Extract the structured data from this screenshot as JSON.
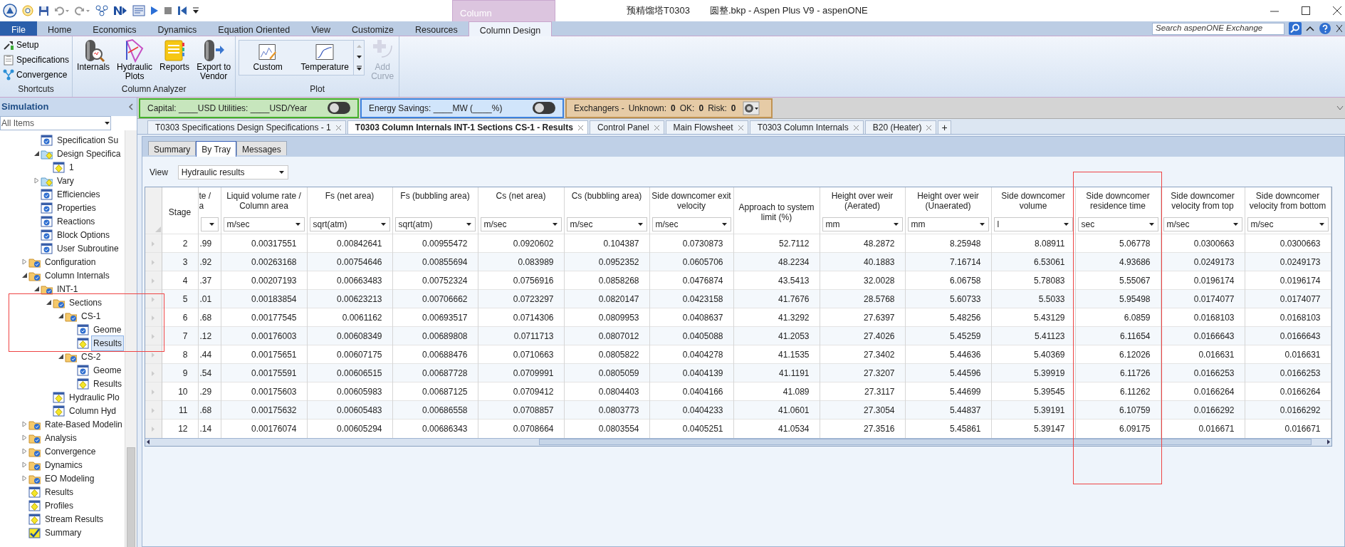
{
  "window": {
    "title_project": "预精馏塔T0303",
    "title_file": "圆整.bkp - Aspen Plus V9 - aspenONE",
    "context_tab": "Column"
  },
  "ribbon": {
    "tabs": [
      {
        "label": "File",
        "kind": "file",
        "selected": false
      },
      {
        "label": "Home",
        "kind": "tab",
        "selected": false
      },
      {
        "label": "Economics",
        "kind": "tab",
        "selected": false
      },
      {
        "label": "Dynamics",
        "kind": "tab",
        "selected": false
      },
      {
        "label": "Equation Oriented",
        "kind": "tab",
        "selected": false
      },
      {
        "label": "View",
        "kind": "tab",
        "selected": false
      },
      {
        "label": "Customize",
        "kind": "tab",
        "selected": false
      },
      {
        "label": "Resources",
        "kind": "tab",
        "selected": false
      },
      {
        "label": "Column Design",
        "kind": "tab",
        "selected": true
      }
    ],
    "search": {
      "placeholder": "Search aspenONE Exchange"
    },
    "groups": [
      {
        "label": "Shortcuts",
        "buttons": [
          {
            "label": "Setup",
            "kind": "small",
            "disabled": false
          },
          {
            "label": "Specifications",
            "kind": "small",
            "disabled": false
          },
          {
            "label": "Convergence",
            "kind": "small",
            "disabled": false
          }
        ]
      },
      {
        "label": "Column Analyzer",
        "buttons": [
          {
            "label": "Internals",
            "kind": "large",
            "disabled": false
          },
          {
            "label": "Hydraulic\nPlots",
            "kind": "large",
            "disabled": false
          },
          {
            "label": "Reports",
            "kind": "large",
            "disabled": false
          },
          {
            "label": "Export to\nVendor",
            "kind": "large",
            "disabled": false
          }
        ]
      },
      {
        "label": "Plot",
        "buttons": [
          {
            "label": "Custom",
            "kind": "gallery",
            "disabled": false
          },
          {
            "label": "Temperature",
            "kind": "gallery",
            "disabled": false
          },
          {
            "label": "Add\nCurve",
            "kind": "large",
            "disabled": true
          }
        ]
      }
    ]
  },
  "navigator": {
    "title": "Simulation",
    "filter": "All Items",
    "tree": [
      {
        "children": [
          {
            "label": "Specification Su",
            "kind": "form",
            "selected": false
          },
          {
            "label": "Design Specifica",
            "kind": "result-folder",
            "selected": false,
            "expanded": true,
            "children": [
              {
                "label": "1",
                "kind": "result",
                "selected": false
              }
            ]
          },
          {
            "label": "Vary",
            "kind": "result-folder",
            "selected": false,
            "expanded": false
          },
          {
            "label": "Efficiencies",
            "kind": "form",
            "selected": false
          },
          {
            "label": "Properties",
            "kind": "form",
            "selected": false
          },
          {
            "label": "Reactions",
            "kind": "form",
            "selected": false
          },
          {
            "label": "Block Options",
            "kind": "form",
            "selected": false
          },
          {
            "label": "User Subroutine",
            "kind": "form",
            "selected": false
          }
        ]
      },
      {
        "label": "Configuration",
        "kind": "folder",
        "selected": false,
        "expanded": false
      },
      {
        "label": "Column Internals",
        "kind": "folder",
        "selected": false,
        "expanded": true,
        "children": [
          {
            "label": "INT-1",
            "kind": "folder",
            "selected": false,
            "expanded": true,
            "children": [
              {
                "label": "Sections",
                "kind": "folder",
                "selected": false,
                "expanded": true,
                "annotated": true,
                "children": [
                  {
                    "label": "CS-1",
                    "kind": "folder",
                    "selected": false,
                    "expanded": true,
                    "annotated": true,
                    "children": [
                      {
                        "label": "Geome",
                        "kind": "form",
                        "selected": false,
                        "annotated": true
                      },
                      {
                        "label": "Results",
                        "kind": "result",
                        "selected": true,
                        "annotated": true
                      }
                    ]
                  },
                  {
                    "label": "CS-2",
                    "kind": "folder",
                    "selected": false,
                    "expanded": true,
                    "children": [
                      {
                        "label": "Geome",
                        "kind": "form",
                        "selected": false
                      },
                      {
                        "label": "Results",
                        "kind": "result",
                        "selected": false
                      }
                    ]
                  }
                ]
              },
              {
                "label": "Hydraulic Plo",
                "kind": "result",
                "selected": false
              },
              {
                "label": "Column Hyd",
                "kind": "result",
                "selected": false
              }
            ]
          }
        ]
      },
      {
        "label": "Rate-Based Modelin",
        "kind": "folder",
        "selected": false,
        "expanded": false
      },
      {
        "label": "Analysis",
        "kind": "folder",
        "selected": false,
        "expanded": false
      },
      {
        "label": "Convergence",
        "kind": "folder",
        "selected": false,
        "expanded": false
      },
      {
        "label": "Dynamics",
        "kind": "folder",
        "selected": false,
        "expanded": false
      },
      {
        "label": "EO Modeling",
        "kind": "folder",
        "selected": false,
        "expanded": false
      },
      {
        "label": "Results",
        "kind": "result",
        "selected": false
      },
      {
        "label": "Profiles",
        "kind": "result",
        "selected": false
      },
      {
        "label": "Stream Results",
        "kind": "result",
        "selected": false
      },
      {
        "label": "Summary",
        "kind": "summary",
        "selected": false
      }
    ]
  },
  "dashboard": [
    {
      "kind": "capital",
      "text": "Capital: ____USD   Utilities: ____USD/Year",
      "on": false
    },
    {
      "kind": "energy",
      "text": "Energy Savings: ____MW    (____%)",
      "on": false
    },
    {
      "kind": "exchangers",
      "parts": [
        "Exchangers -",
        "Unknown:",
        "0",
        "OK:",
        "0",
        "Risk:",
        "0"
      ]
    }
  ],
  "document_tabs": [
    {
      "label": "T0303 Specifications Design Specifications - 1",
      "kind": "doc",
      "selected": false
    },
    {
      "label": "T0303 Column Internals INT-1 Sections CS-1 - Results",
      "kind": "doc",
      "selected": true
    },
    {
      "label": "Control Panel",
      "kind": "doc",
      "selected": false
    },
    {
      "label": "Main Flowsheet",
      "kind": "doc",
      "selected": false
    },
    {
      "label": "T0303 Column Internals",
      "kind": "doc",
      "selected": false
    },
    {
      "label": "B20 (Heater)",
      "kind": "doc",
      "selected": false
    },
    {
      "label": "+",
      "kind": "add",
      "selected": false
    }
  ],
  "form_tabs": [
    {
      "label": "Summary",
      "selected": false
    },
    {
      "label": "By Tray",
      "selected": true
    },
    {
      "label": "Messages",
      "selected": false
    }
  ],
  "view": {
    "label": "View",
    "value": "Hydraulic results"
  },
  "table": {
    "columns": [
      {
        "header": "Stage",
        "kind": "stage"
      },
      {
        "header": "te /\na",
        "kind": "unit"
      },
      {
        "header": "Liquid volume rate / Column area",
        "kind": "unit",
        "unit": "m/sec"
      },
      {
        "header": "Fs (net area)",
        "kind": "unit",
        "unit": "sqrt(atm)"
      },
      {
        "header": "Fs (bubbling area)",
        "kind": "unit",
        "unit": "sqrt(atm)"
      },
      {
        "header": "Cs (net area)",
        "kind": "unit",
        "unit": "m/sec"
      },
      {
        "header": "Cs (bubbling area)",
        "kind": "unit",
        "unit": "m/sec"
      },
      {
        "header": "Side downcomer exit velocity",
        "kind": "unit",
        "unit": "m/sec"
      },
      {
        "header": "Approach to system limit (%)",
        "kind": "plain"
      },
      {
        "header": "Height over weir (Aerated)",
        "kind": "unit",
        "unit": "mm"
      },
      {
        "header": "Height over weir (Unaerated)",
        "kind": "unit",
        "unit": "mm"
      },
      {
        "header": "Side downcomer volume",
        "kind": "unit",
        "unit": "l"
      },
      {
        "header": "Side downcomer residence time",
        "kind": "unit",
        "unit": "sec",
        "annotated": true
      },
      {
        "header": "Side downcomer velocity from top",
        "kind": "unit",
        "unit": "m/sec"
      },
      {
        "header": "Side downcomer velocity from bottom",
        "kind": "unit",
        "unit": "m/sec"
      }
    ],
    "rows": [
      {
        "cells": [
          "2",
          ".99",
          "0.00317551",
          "0.00842641",
          "0.00955472",
          "0.0920602",
          "0.104387",
          "0.0730873",
          "52.7112",
          "48.2872",
          "8.25948",
          "8.08911",
          "5.06778",
          "0.0300663",
          "0.0300663"
        ]
      },
      {
        "cells": [
          "3",
          ".92",
          "0.00263168",
          "0.00754646",
          "0.00855694",
          "0.083989",
          "0.0952352",
          "0.0605706",
          "48.2234",
          "40.1883",
          "7.16714",
          "6.53061",
          "4.93686",
          "0.0249173",
          "0.0249173"
        ]
      },
      {
        "cells": [
          "4",
          ".37",
          "0.00207193",
          "0.00663483",
          "0.00752324",
          "0.0756916",
          "0.0858268",
          "0.0476874",
          "43.5413",
          "32.0028",
          "6.06758",
          "5.78083",
          "5.55067",
          "0.0196174",
          "0.0196174"
        ]
      },
      {
        "cells": [
          "5",
          ".01",
          "0.00183854",
          "0.00623213",
          "0.00706662",
          "0.0723297",
          "0.0820147",
          "0.0423158",
          "41.7676",
          "28.5768",
          "5.60733",
          "5.5033",
          "5.95498",
          "0.0174077",
          "0.0174077"
        ]
      },
      {
        "cells": [
          "6",
          ".68",
          "0.00177545",
          "0.0061162",
          "0.00693517",
          "0.0714306",
          "0.0809953",
          "0.0408637",
          "41.3292",
          "27.6397",
          "5.48256",
          "5.43129",
          "6.0859",
          "0.0168103",
          "0.0168103"
        ]
      },
      {
        "cells": [
          "7",
          ".12",
          "0.00176003",
          "0.00608349",
          "0.00689808",
          "0.0711713",
          "0.0807012",
          "0.0405088",
          "41.2053",
          "27.4026",
          "5.45259",
          "5.41123",
          "6.11654",
          "0.0166643",
          "0.0166643"
        ]
      },
      {
        "cells": [
          "8",
          ".44",
          "0.00175651",
          "0.00607175",
          "0.00688476",
          "0.0710663",
          "0.0805822",
          "0.0404278",
          "41.1535",
          "27.3402",
          "5.44636",
          "5.40369",
          "6.12026",
          "0.016631",
          "0.016631"
        ]
      },
      {
        "cells": [
          "9",
          ".54",
          "0.00175591",
          "0.00606515",
          "0.00687728",
          "0.0709991",
          "0.0805059",
          "0.0404139",
          "41.1191",
          "27.3207",
          "5.44596",
          "5.39919",
          "6.11726",
          "0.0166253",
          "0.0166253"
        ]
      },
      {
        "cells": [
          "10",
          ".29",
          "0.00175603",
          "0.00605983",
          "0.00687125",
          "0.0709412",
          "0.0804403",
          "0.0404166",
          "41.089",
          "27.3117",
          "5.44699",
          "5.39545",
          "6.11262",
          "0.0166264",
          "0.0166264"
        ]
      },
      {
        "cells": [
          "11",
          ".68",
          "0.00175632",
          "0.00605483",
          "0.00686558",
          "0.0708857",
          "0.0803773",
          "0.0404233",
          "41.0601",
          "27.3054",
          "5.44837",
          "5.39191",
          "6.10759",
          "0.0166292",
          "0.0166292"
        ]
      },
      {
        "cells": [
          "12",
          ".14",
          "0.00176074",
          "0.00605294",
          "0.00686343",
          "0.0708664",
          "0.0803554",
          "0.0405251",
          "41.0534",
          "27.3516",
          "5.45861",
          "5.39147",
          "6.09175",
          "0.016671",
          "0.016671"
        ]
      }
    ]
  }
}
